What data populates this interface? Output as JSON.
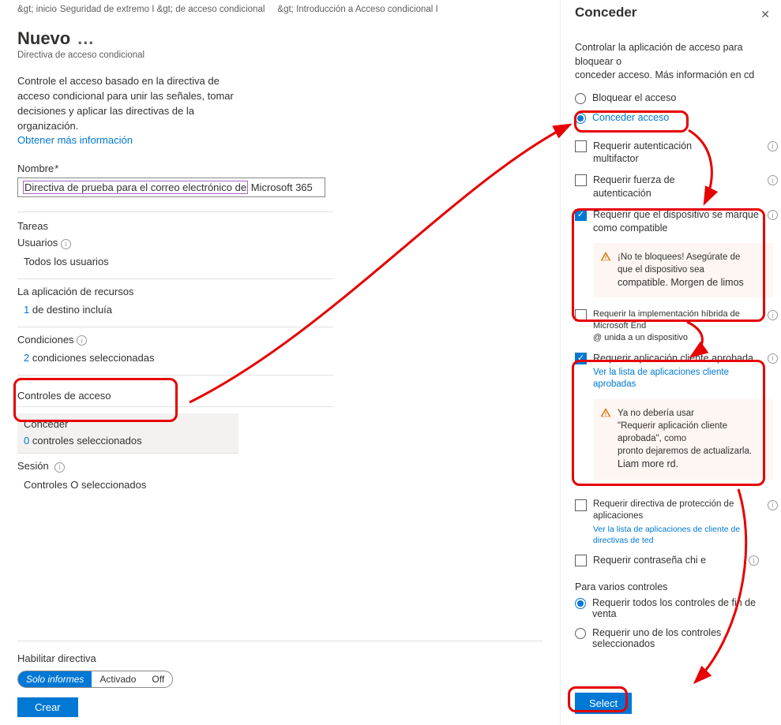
{
  "breadcrumbs": {
    "b1": "&gt; inicio",
    "b2": "Seguridad de extremo I &gt; de acceso condicional",
    "b3": "&gt; Introducción a Acceso condicional I"
  },
  "title": "Nuevo",
  "subtitle": "Directiva de acceso condicional",
  "intro_l1": "Controle el acceso basado en la directiva de",
  "intro_l2": "acceso condicional para unir las señales, tomar",
  "intro_l3": "decisiones y aplicar las directivas de la organización.",
  "intro_link": "Obtener más información",
  "name_label": "Nombre",
  "name_value_a": "Directiva de prueba para el correo electrónico de",
  "name_value_b": " Microsoft 365",
  "tareas": "Tareas",
  "users": {
    "label": "Usuarios",
    "value": "Todos los usuarios"
  },
  "apps": {
    "label": "La aplicación de recursos",
    "num": "1",
    "rest": " de destino incluía"
  },
  "cond": {
    "label": "Condiciones",
    "num": "2",
    "rest": " condiciones seleccionadas"
  },
  "access_controls": "Controles de acceso",
  "grant": {
    "label": "Conceder",
    "num": "0",
    "rest": " controles seleccionados"
  },
  "session": {
    "label": "Sesión",
    "value": "Controles O seleccionados"
  },
  "enable_label": "Habilitar directiva",
  "toggle": {
    "a": "Solo informes",
    "b": "Activado",
    "c": "Off"
  },
  "create": "Crear",
  "rp": {
    "title": "Conceder",
    "intro1": "Controlar la aplicación de acceso para bloquear o",
    "intro2": "conceder acceso. Más información en cd",
    "r_block": "Bloquear el acceso",
    "r_grant": "Conceder acceso",
    "c_mfa_a": "Requerir autenticación",
    "c_mfa_b": "multifactor",
    "c_str_a": "Requerir fuerza de",
    "c_str_b": "autenticación",
    "c_compat_a": "Requerir que el dispositivo se marque",
    "c_compat_b": "como compatible",
    "warn1_a": "¡No te bloquees! Asegúrate de",
    "warn1_b": "que el dispositivo sea",
    "warn1_c": "compatible. Morgen de limos",
    "c_hybrid_a": "Requerir la implementación híbrida de Microsoft End",
    "c_hybrid_b": "@ unida a un dispositivo",
    "c_app": "Requerir aplicación cliente aprobada",
    "c_app_link": "Ver la lista de aplicaciones cliente aprobadas",
    "warn2_a": "Ya no debería usar",
    "warn2_b": "\"Requerir aplicación cliente aprobada\", como",
    "warn2_c": "pronto dejaremos de actualizarla.",
    "warn2_d": "Liam more rd.",
    "c_prot": "Requerir directiva de protección de aplicaciones",
    "c_prot_link": "Ver la lista de aplicaciones de cliente de directivas de ted",
    "c_pwd": "Requerir contraseña chi e",
    "multi_label": "Para varios controles",
    "r_all": "Requerir todos los controles de fin de venta",
    "r_one": "Requerir uno de los controles seleccionados",
    "select": "Select"
  }
}
